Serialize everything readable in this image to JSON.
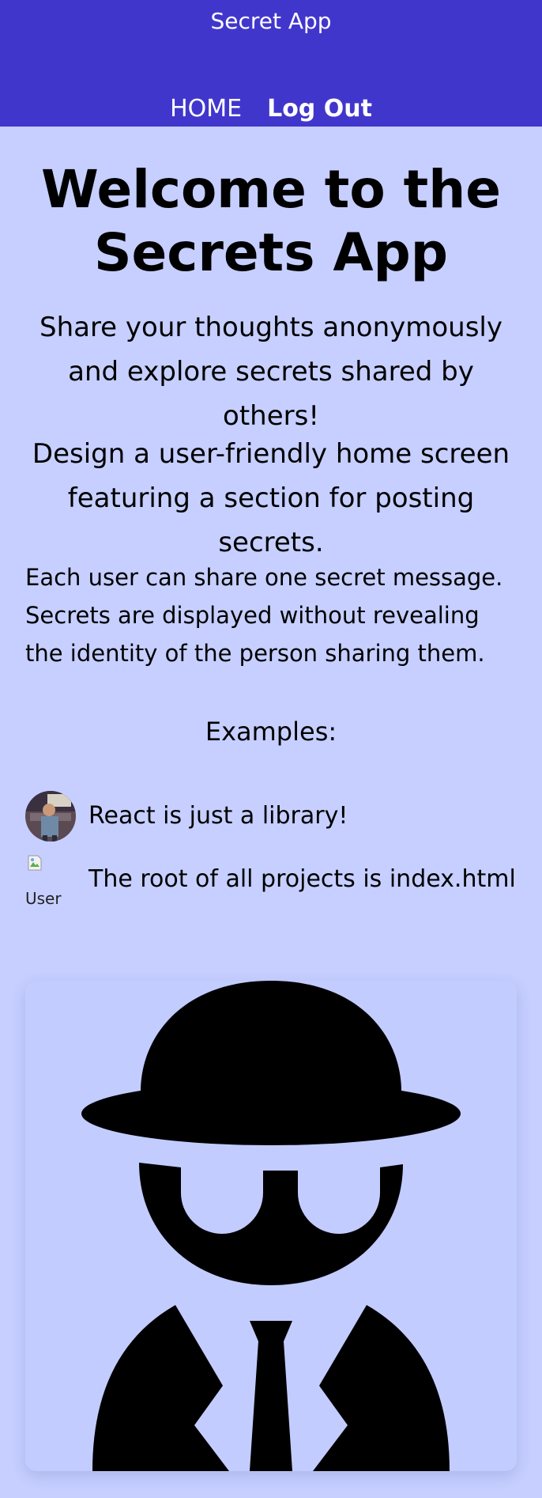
{
  "header": {
    "title": "Secret App",
    "nav": {
      "home_label": "HOME",
      "logout_label": "Log Out"
    }
  },
  "main": {
    "headline": "Welcome to the Secrets App",
    "lead": "Share your thoughts anonymously and explore secrets shared by others!",
    "lead2": "Design a user-friendly home screen featuring a section for posting secrets.",
    "description": "Each user can share one secret message. Secrets are displayed without revealing the identity of the person sharing them.",
    "examples_title": "Examples:",
    "examples": [
      {
        "text": "React is just a library!",
        "avatar": "user-photo"
      },
      {
        "text": "The root of all projects is index.html",
        "avatar": "broken-image",
        "alt": "User"
      }
    ],
    "illustration": "spy-icon"
  },
  "colors": {
    "header_bg": "#4136cc",
    "page_bg": "#c6cfff"
  }
}
